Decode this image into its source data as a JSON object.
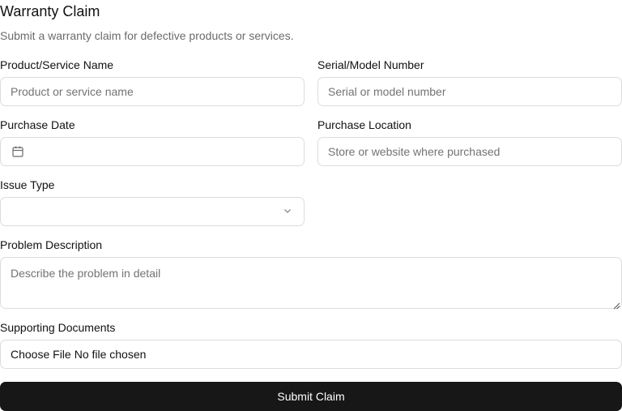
{
  "form": {
    "title": "Warranty Claim",
    "subtitle": "Submit a warranty claim for defective products or services.",
    "product": {
      "label": "Product/Service Name",
      "placeholder": "Product or service name",
      "value": ""
    },
    "serial": {
      "label": "Serial/Model Number",
      "placeholder": "Serial or model number",
      "value": ""
    },
    "purchase_date": {
      "label": "Purchase Date",
      "value": "",
      "icon": "calendar-icon"
    },
    "purchase_location": {
      "label": "Purchase Location",
      "placeholder": "Store or website where purchased",
      "value": ""
    },
    "issue_type": {
      "label": "Issue Type",
      "selected": "",
      "icon": "chevron-down-icon"
    },
    "problem": {
      "label": "Problem Description",
      "placeholder": "Describe the problem in detail",
      "value": ""
    },
    "documents": {
      "label": "Supporting Documents",
      "button_label": "Choose File",
      "status": "No file chosen"
    },
    "submit_label": "Submit Claim"
  },
  "colors": {
    "primary_button_bg": "#171717",
    "primary_button_text": "#ffffff",
    "border": "#dcdcdc",
    "muted_text": "#6b6b6b",
    "placeholder": "#737373"
  }
}
